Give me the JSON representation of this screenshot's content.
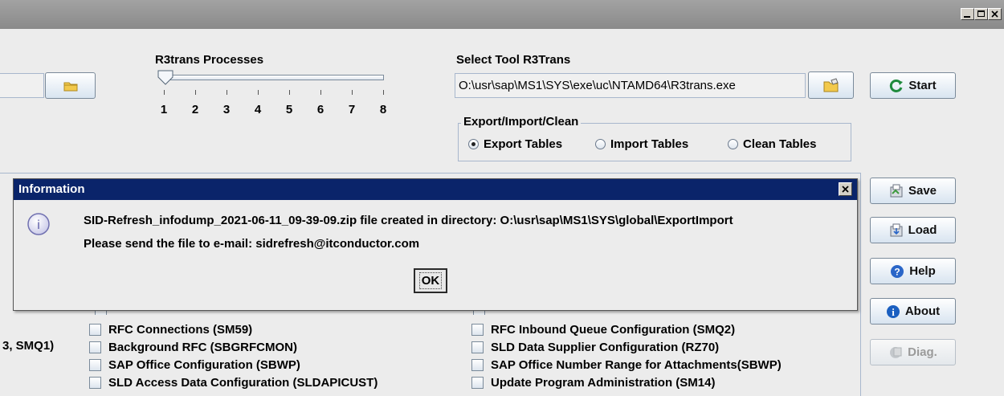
{
  "window": {
    "title": ""
  },
  "r3trans": {
    "processes_label": "R3trans Processes",
    "slider_value": 1,
    "slider_ticks": [
      "1",
      "2",
      "3",
      "4",
      "5",
      "6",
      "7",
      "8"
    ],
    "select_tool_label": "Select Tool R3Trans",
    "tool_path": "O:\\usr\\sap\\MS1\\SYS\\exe\\uc\\NTAMD64\\R3trans.exe"
  },
  "mode_group": {
    "title": "Export/Import/Clean",
    "options": [
      "Export Tables",
      "Import Tables",
      "Clean Tables"
    ],
    "selected": "Export Tables"
  },
  "buttons": {
    "start": "Start",
    "save": "Save",
    "load": "Load",
    "help": "Help",
    "about": "About",
    "diag": "Diag."
  },
  "dialog": {
    "title": "Information",
    "line1": "SID-Refresh_infodump_2021-06-11_09-39-09.zip file created in directory: O:\\usr\\sap\\MS1\\SYS\\global\\ExportImport",
    "line2": "Please send the file to  e-mail: sidrefresh@itconductor.com",
    "ok": "OK"
  },
  "checklist": {
    "left_partial": "3, SMQ1)",
    "col1": [
      "RFC Connections (SM59)",
      "Background RFC (SBGRFCMON)",
      "SAP Office Configuration (SBWP)",
      "SLD Access Data Configuration (SLDAPICUST)"
    ],
    "col2": [
      "RFC Inbound Queue Configuration (SMQ2)",
      "SLD Data Supplier Configuration (RZ70)",
      "SAP Office Number Range for Attachments(SBWP)",
      "Update Program Administration (SM14)"
    ]
  },
  "colors": {
    "dialog_title_bg": "#0a246a",
    "start_icon": "#1e8a3c",
    "help_icon": "#2a66c8",
    "about_icon": "#1a5fc0"
  }
}
